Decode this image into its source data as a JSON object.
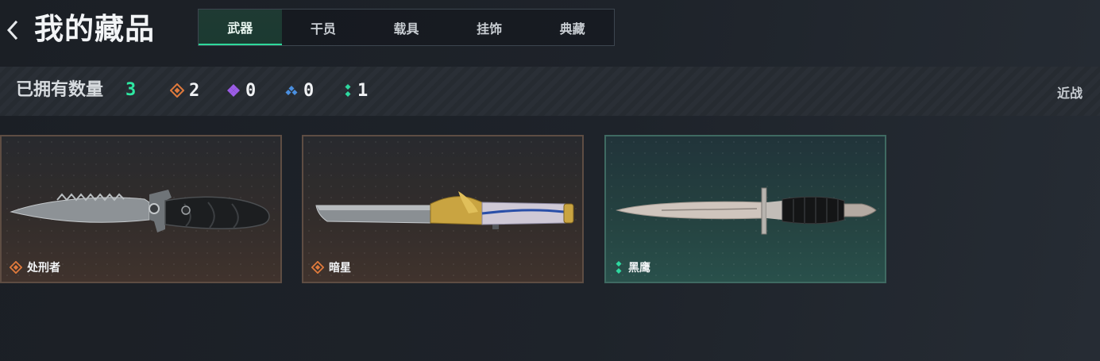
{
  "header": {
    "title": "我的藏品",
    "tabs": [
      {
        "label": "武器",
        "active": true
      },
      {
        "label": "干员",
        "active": false
      },
      {
        "label": "载具",
        "active": false
      },
      {
        "label": "挂饰",
        "active": false
      },
      {
        "label": "典藏",
        "active": false
      }
    ]
  },
  "stats": {
    "label": "已拥有数量",
    "total": "3",
    "rarities": [
      {
        "icon": "orange-diamond-icon",
        "count": "2",
        "color": "#e07a3c"
      },
      {
        "icon": "purple-diamond-icon",
        "count": "0",
        "color": "#9b5ce6"
      },
      {
        "icon": "blue-diamond-icon",
        "count": "0",
        "color": "#4a8fe0"
      },
      {
        "icon": "green-diamond-icon",
        "count": "1",
        "color": "#2ed9a0"
      }
    ],
    "filter": "近战"
  },
  "cards": [
    {
      "name": "处刑者",
      "rarity": "orange",
      "icon": "orange-diamond-icon"
    },
    {
      "name": "暗星",
      "rarity": "orange",
      "icon": "orange-diamond-icon"
    },
    {
      "name": "黑鹰",
      "rarity": "teal",
      "icon": "green-diamond-icon"
    }
  ],
  "colors": {
    "accent": "#2ee8a2",
    "tab_active_border": "#2ed99b",
    "card_orange_border": "#5e4d43",
    "card_teal_border": "#3f6a62"
  }
}
